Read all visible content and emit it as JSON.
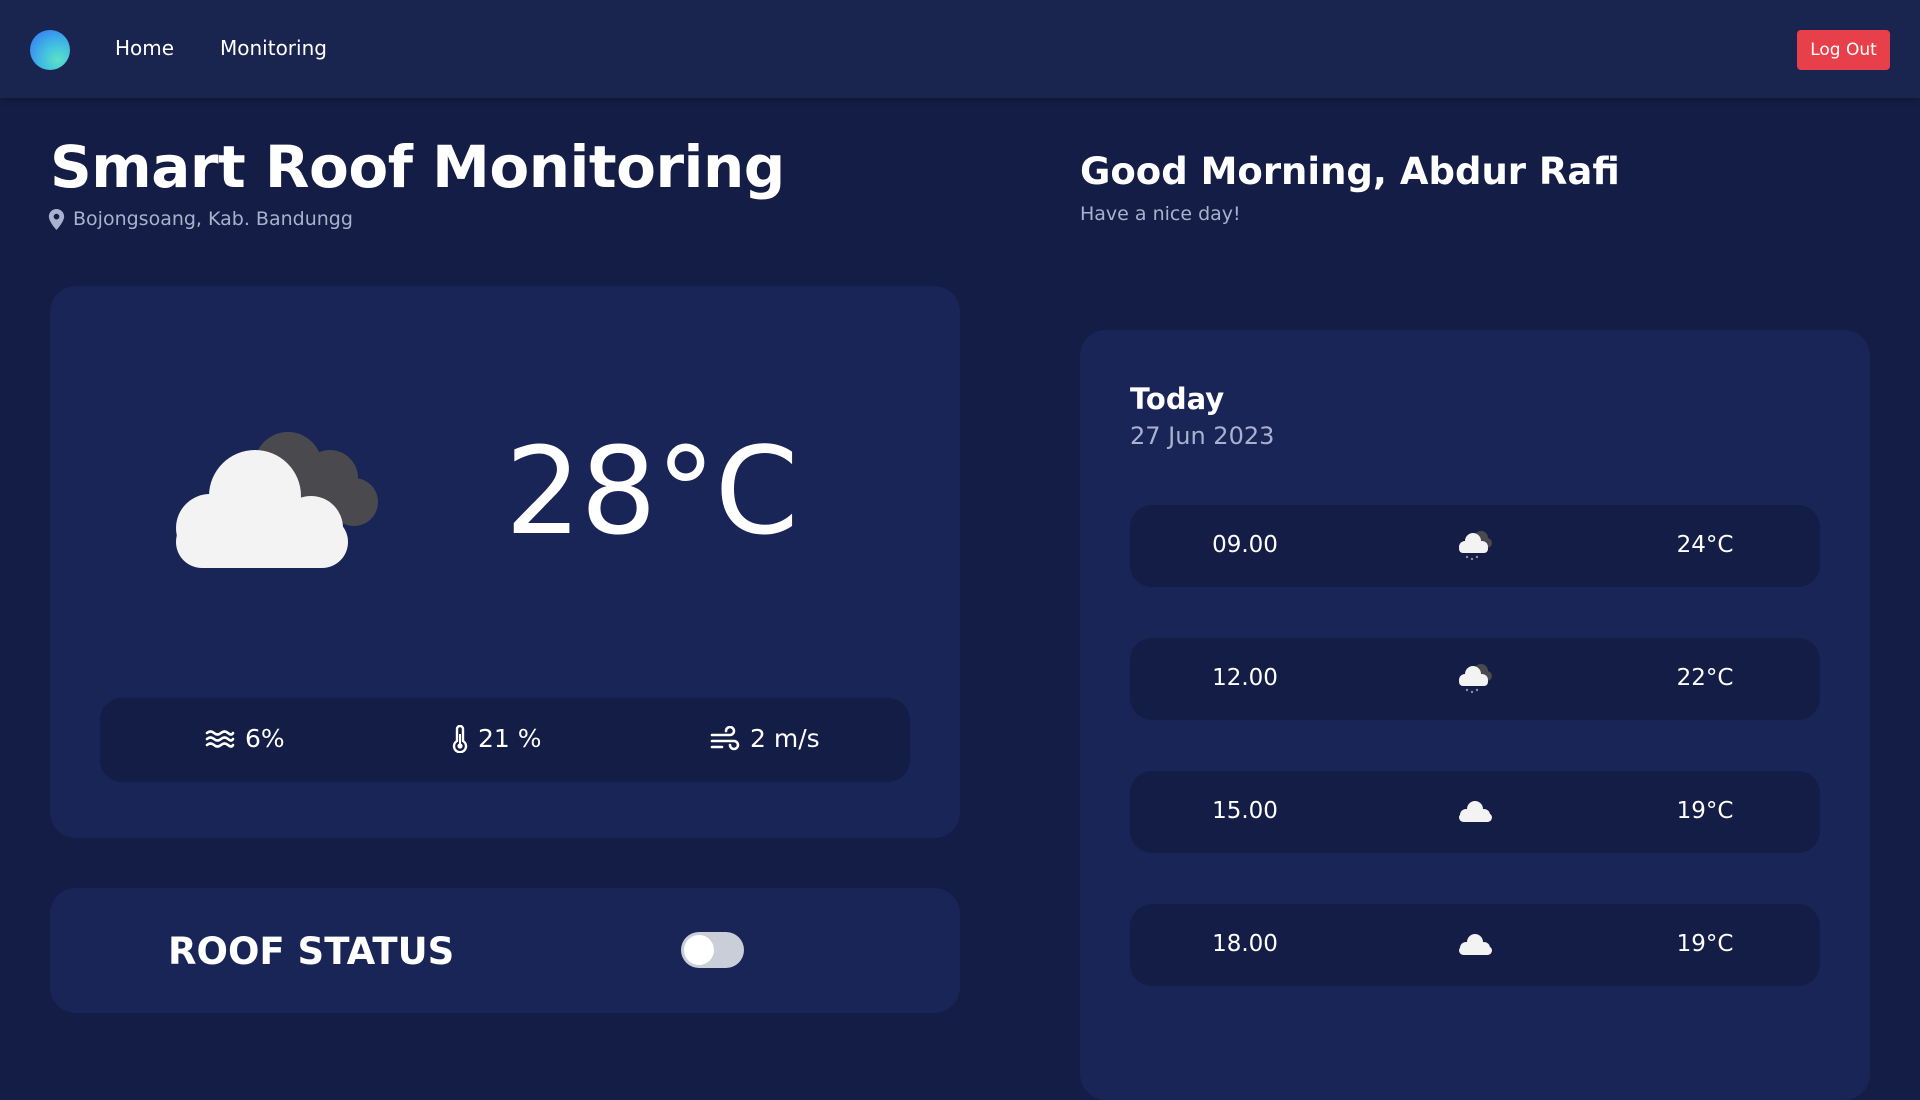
{
  "nav": {
    "logo_icon": "gradient-circle-logo",
    "home_label": "Home",
    "monitoring_label": "Monitoring",
    "logout_label": "Log Out"
  },
  "header": {
    "title": "Smart Roof Monitoring",
    "location_icon": "map-pin-icon",
    "location": "Bojongsoang, Kab. Bandungg",
    "greeting": "Good Morning, Abdur Rafi",
    "greeting_sub": "Have a nice day!"
  },
  "current_weather": {
    "condition_icon": "cloudy-icon",
    "temperature": "28°C",
    "stats": [
      {
        "icon": "wind-waves-icon",
        "value": "6%"
      },
      {
        "icon": "thermometer-icon",
        "value": "21 %"
      },
      {
        "icon": "wind-speed-icon",
        "value": "2 m/s"
      }
    ]
  },
  "roof": {
    "label": "ROOF STATUS",
    "toggle_on": false
  },
  "forecast": {
    "title": "Today",
    "date": "27 Jun 2023",
    "rows": [
      {
        "time": "09.00",
        "icon": "rain-cloud-icon",
        "temp": "24°C"
      },
      {
        "time": "12.00",
        "icon": "rain-cloud-icon",
        "temp": "22°C"
      },
      {
        "time": "15.00",
        "icon": "cloud-icon",
        "temp": "19°C"
      },
      {
        "time": "18.00",
        "icon": "cloud-icon",
        "temp": "19°C"
      }
    ]
  },
  "colors": {
    "page_bg": "#141d45",
    "card_bg": "#1a2557",
    "navbar_bg": "#19244f",
    "logout_bg": "#e8404a",
    "muted_text": "#a9b1cc"
  }
}
